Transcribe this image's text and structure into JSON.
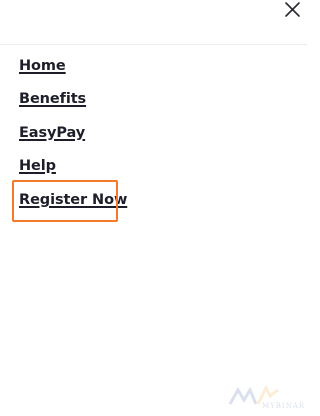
{
  "header": {
    "close_icon": "close-icon"
  },
  "menu": {
    "items": [
      {
        "label": "Home"
      },
      {
        "label": "Benefits"
      },
      {
        "label": "EasyPay"
      },
      {
        "label": "Help"
      },
      {
        "label": "Register Now"
      }
    ],
    "highlighted_item": "Register Now",
    "highlight_color": "#f47a2a"
  },
  "watermark": {
    "logo_icon": "wordmark-logo",
    "text": "MYBINAR"
  }
}
